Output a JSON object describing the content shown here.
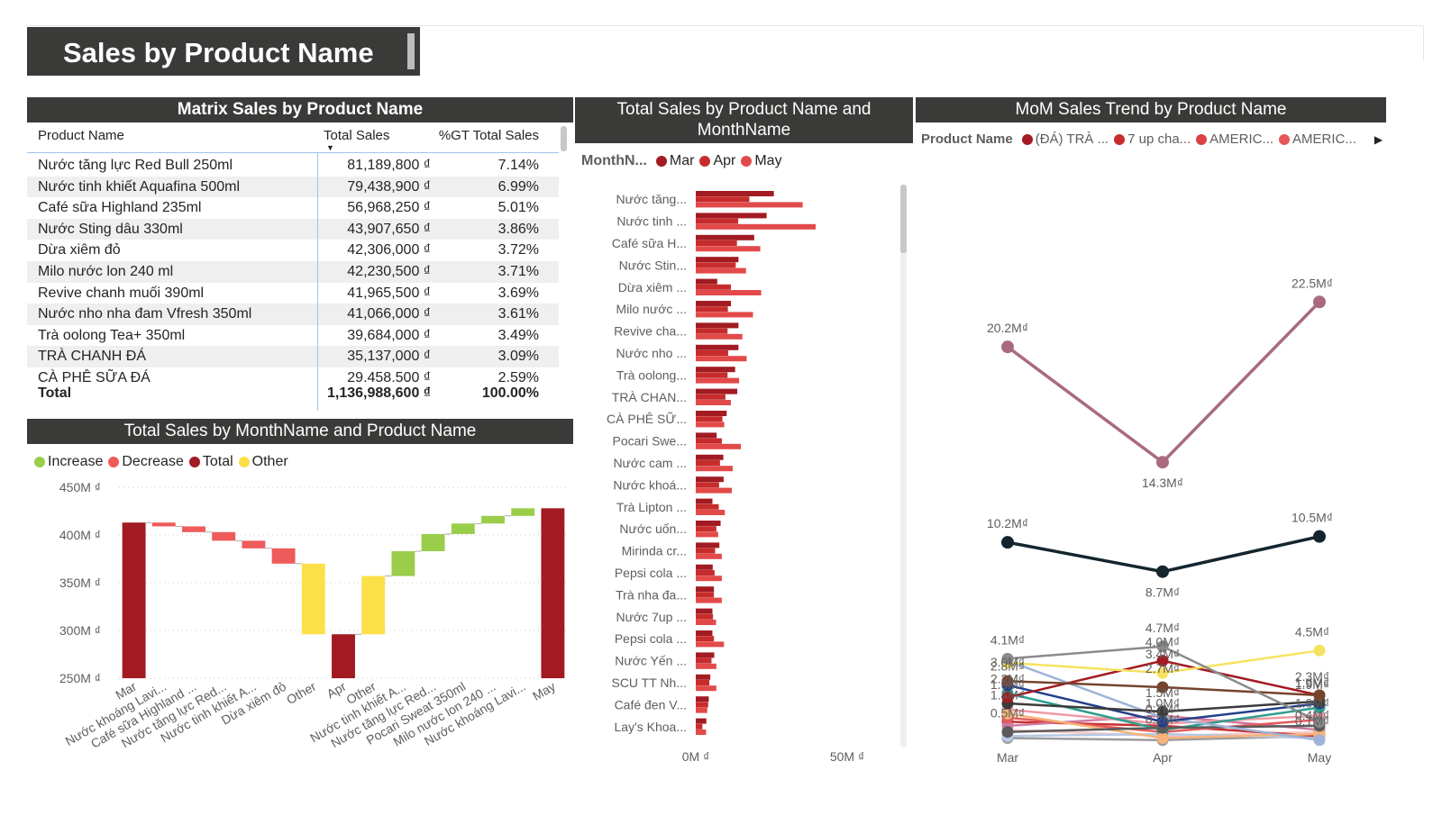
{
  "page": {
    "title": "Sales by Product Name"
  },
  "matrix": {
    "title": "Matrix Sales by Product Name",
    "columns": {
      "product": "Product Name",
      "sales": "Total Sales",
      "pct": "%GT Total Sales"
    },
    "rows": [
      {
        "product": "Nước tăng lực Red Bull 250ml",
        "sales": "81,189,800 ₫",
        "pct": "7.14%"
      },
      {
        "product": "Nước tinh khiết Aquafina 500ml",
        "sales": "79,438,900 ₫",
        "pct": "6.99%"
      },
      {
        "product": "Café sữa Highland 235ml",
        "sales": "56,968,250 ₫",
        "pct": "5.01%"
      },
      {
        "product": "Nước Sting dâu 330ml",
        "sales": "43,907,650 ₫",
        "pct": "3.86%"
      },
      {
        "product": "Dừa xiêm đỏ",
        "sales": "42,306,000 ₫",
        "pct": "3.72%"
      },
      {
        "product": "Milo nước lon 240 ml",
        "sales": "42,230,500 ₫",
        "pct": "3.71%"
      },
      {
        "product": "Revive chanh muối 390ml",
        "sales": "41,965,500 ₫",
        "pct": "3.69%"
      },
      {
        "product": "Nước nho nha đam Vfresh 350ml",
        "sales": "41,066,000 ₫",
        "pct": "3.61%"
      },
      {
        "product": "Trà oolong Tea+ 350ml",
        "sales": "39,684,000 ₫",
        "pct": "3.49%"
      },
      {
        "product": "TRÀ CHANH ĐÁ",
        "sales": "35,137,000 ₫",
        "pct": "3.09%"
      },
      {
        "product": "CÀ PHÊ SỮA ĐÁ",
        "sales": "29,458,500 ₫",
        "pct": "2.59%"
      }
    ],
    "total": {
      "label": "Total",
      "sales": "1,136,988,600 ₫",
      "pct": "100.00%"
    }
  },
  "chart_data": [
    {
      "type": "bar",
      "subtype": "waterfall",
      "title": "Total Sales by MonthName and Product Name",
      "legend": [
        "Increase",
        "Decrease",
        "Total",
        "Other"
      ],
      "legend_colors": {
        "Increase": "#9acd4a",
        "Decrease": "#ef5a5a",
        "Total": "#a21b22",
        "Other": "#fbe04a"
      },
      "ylim": [
        250,
        450
      ],
      "yticks": [
        250,
        300,
        350,
        400,
        450
      ],
      "ytick_labels": [
        "250M ₫",
        "300M ₫",
        "350M ₫",
        "400M ₫",
        "450M ₫"
      ],
      "steps": [
        {
          "label": "Mar",
          "kind": "Total",
          "start": 250,
          "end": 413
        },
        {
          "label": "Nước khoáng Lavi...",
          "kind": "Decrease",
          "start": 413,
          "end": 409
        },
        {
          "label": "Café sữa Highland ...",
          "kind": "Decrease",
          "start": 409,
          "end": 403
        },
        {
          "label": "Nước tăng lực Red...",
          "kind": "Decrease",
          "start": 403,
          "end": 394
        },
        {
          "label": "Nước tinh khiết A...",
          "kind": "Decrease",
          "start": 394,
          "end": 386
        },
        {
          "label": "Dừa xiêm đỏ",
          "kind": "Decrease",
          "start": 386,
          "end": 370
        },
        {
          "label": "Other",
          "kind": "Other",
          "start": 370,
          "end": 296
        },
        {
          "label": "Apr",
          "kind": "Total",
          "start": 250,
          "end": 296
        },
        {
          "label": "Other",
          "kind": "Other",
          "start": 296,
          "end": 357
        },
        {
          "label": "Nước tinh khiết A...",
          "kind": "Increase",
          "start": 357,
          "end": 383
        },
        {
          "label": "Nước tăng lực Red...",
          "kind": "Increase",
          "start": 383,
          "end": 401
        },
        {
          "label": "Pocari Sweat 350ml",
          "kind": "Increase",
          "start": 401,
          "end": 412
        },
        {
          "label": "Milo nước lon 240 ...",
          "kind": "Increase",
          "start": 412,
          "end": 420
        },
        {
          "label": "Nước khoáng Lavi...",
          "kind": "Increase",
          "start": 420,
          "end": 428
        },
        {
          "label": "May",
          "kind": "Total",
          "start": 250,
          "end": 428
        }
      ]
    },
    {
      "type": "bar",
      "orientation": "horizontal",
      "title": "Total Sales by Product Name and MonthName",
      "legend_title": "MonthN...",
      "series": [
        {
          "name": "Mar",
          "color": "#a21b22",
          "values": [
            25.8,
            23.4,
            19.3,
            14.1,
            7.1,
            11.6,
            14.1,
            14.1,
            13.0,
            13.7,
            10.2,
            6.9,
            9.1,
            9.2,
            5.5,
            8.2,
            7.8,
            5.6,
            6.0,
            5.5,
            5.5,
            6.1,
            4.8,
            4.3,
            3.5
          ]
        },
        {
          "name": "Apr",
          "color": "#c72c2c",
          "values": [
            17.7,
            14.0,
            13.6,
            13.2,
            11.6,
            10.6,
            10.5,
            10.7,
            10.5,
            9.8,
            8.8,
            8.6,
            8.0,
            7.7,
            7.6,
            6.8,
            6.4,
            6.2,
            6.0,
            5.7,
            6.0,
            5.2,
            4.5,
            4.1,
            2.2
          ]
        },
        {
          "name": "May",
          "color": "#e24a4a",
          "values": [
            35.3,
            39.6,
            21.3,
            16.6,
            21.6,
            18.9,
            15.4,
            16.8,
            14.3,
            11.6,
            9.4,
            14.9,
            12.2,
            11.9,
            9.6,
            7.4,
            8.6,
            8.6,
            8.6,
            6.7,
            9.3,
            6.8,
            6.8,
            3.8,
            3.4
          ]
        }
      ],
      "categories": [
        "Nước tăng...",
        "Nước tinh ...",
        "Café sữa H...",
        "Nước Stin...",
        "Dừa xiêm ...",
        "Milo nước ...",
        "Revive cha...",
        "Nước nho ...",
        "Trà oolong...",
        "TRÀ CHAN...",
        "CÀ PHÊ SỮ...",
        "Pocari Swe...",
        "Nước cam ...",
        "Nước khoá...",
        "Trà Lipton ...",
        "Nước uốn...",
        "Mirinda cr...",
        "Pepsi cola ...",
        "Trà nha đa...",
        "Nước 7up ...",
        "Pepsi cola ...",
        "Nước Yến ...",
        "SCU TT Nh...",
        "Café đen V...",
        "Lay's Khoa..."
      ],
      "xlim": [
        0,
        50
      ],
      "xtick_labels": [
        "0M ₫",
        "50M ₫"
      ]
    },
    {
      "type": "line",
      "title": "MoM Sales Trend by Product Name",
      "legend_title": "Product Name",
      "legend": [
        {
          "name": "(ĐÁ) TRÀ ...",
          "color": "#a21b22"
        },
        {
          "name": "7 up cha...",
          "color": "#c72c2c"
        },
        {
          "name": "AMERIC...",
          "color": "#d94343"
        },
        {
          "name": "AMERIC...",
          "color": "#e85858"
        }
      ],
      "x": [
        "Mar",
        "Apr",
        "May"
      ],
      "unit": "M₫",
      "ylim": [
        0,
        25
      ],
      "series": [
        {
          "values": [
            20.2,
            14.3,
            22.5
          ],
          "labels": [
            "20.2M₫",
            "14.3M₫",
            "22.5M₫"
          ],
          "color": "#a96a80"
        },
        {
          "values": [
            10.2,
            8.7,
            10.5
          ],
          "labels": [
            "10.2M₫",
            "8.7M₫",
            "10.5M₫"
          ],
          "color": "#14252f"
        },
        {
          "values": [
            4.1,
            4.7,
            1.0
          ],
          "labels": [
            "4.1M₫",
            "4.7M₫",
            "1.0M₫"
          ],
          "color": "#8a8b8d"
        },
        {
          "values": [
            3.9,
            3.4,
            4.5
          ],
          "labels": [
            "",
            "3.4M₫",
            "4.5M₫"
          ],
          "color": "#f7e25f"
        },
        {
          "values": [
            3.0,
            2.7,
            2.3
          ],
          "labels": [
            "3.0M₫",
            "2.7M₫",
            "2.3M₫"
          ],
          "color": "#76432d"
        },
        {
          "values": [
            2.2,
            4.0,
            2.3
          ],
          "labels": [
            "2.2M₫",
            "4.0M₫",
            ""
          ],
          "color": "#a21b22"
        },
        {
          "values": [
            1.9,
            1.5,
            2.0
          ],
          "labels": [
            "1.9M₫",
            "1.5M₫",
            "1.9M₫"
          ],
          "color": "#3b3b3b"
        },
        {
          "values": [
            2.8,
            1.0,
            1.9
          ],
          "labels": [
            "2.8M₫",
            "1.0M₫",
            "1.9M₫"
          ],
          "color": "#223f8a"
        },
        {
          "values": [
            4.0,
            1.2,
            0.1
          ],
          "labels": [
            "",
            "",
            "0.1M₫"
          ],
          "color": "#9fb3d9"
        },
        {
          "values": [
            0.5,
            0.7,
            0.8
          ],
          "labels": [
            "0.5M₫",
            "0.7M₫",
            ""
          ],
          "color": "#5b5b5b"
        },
        {
          "values": [
            1.4,
            0.2,
            0.4
          ],
          "labels": [
            "1.4M₫",
            "0.2M₫",
            "0.4M₫"
          ],
          "color": "#f6b37a"
        },
        {
          "values": [
            2.4,
            0.6,
            1.7
          ],
          "labels": [
            "",
            "",
            ""
          ],
          "color": "#2e9e8e"
        },
        {
          "values": [
            1.6,
            0.9,
            1.3
          ],
          "labels": [
            "",
            "",
            ""
          ],
          "color": "#f09aa5"
        },
        {
          "values": [
            1.2,
            0.5,
            1.1
          ],
          "labels": [
            "",
            "",
            ""
          ],
          "color": "#e35b5b"
        },
        {
          "values": [
            0.8,
            1.3,
            0.6
          ],
          "labels": [
            "",
            "",
            ""
          ],
          "color": "#d07a9f"
        },
        {
          "values": [
            0.3,
            0.4,
            0.2
          ],
          "labels": [
            "",
            "",
            ""
          ],
          "color": "#b6c9e6"
        },
        {
          "values": [
            1.0,
            0.8,
            0.3
          ],
          "labels": [
            "",
            "",
            ""
          ],
          "color": "#c92f2f"
        },
        {
          "values": [
            0.6,
            0.3,
            0.5
          ],
          "labels": [
            "",
            "",
            ""
          ],
          "color": "#f5c7c7"
        },
        {
          "values": [
            0.2,
            0.1,
            0.3
          ],
          "labels": [
            "",
            "",
            ""
          ],
          "color": "#9b9b9b"
        }
      ]
    }
  ]
}
